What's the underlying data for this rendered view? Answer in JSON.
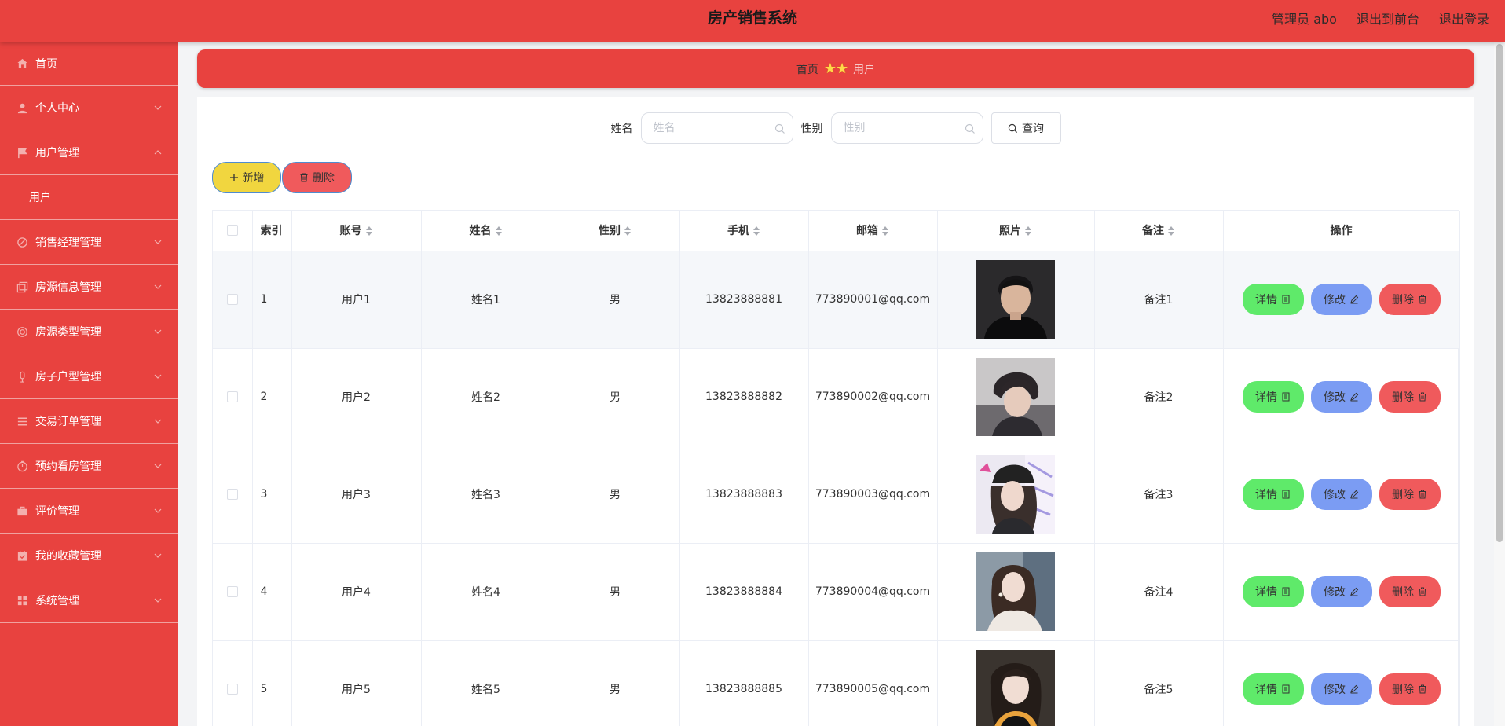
{
  "header": {
    "title": "房产销售系统",
    "admin_label": "管理员 abo",
    "to_front": "退出到前台",
    "logout": "退出登录"
  },
  "sidebar": {
    "items": [
      {
        "label": "首页",
        "icon": "home-icon"
      },
      {
        "label": "个人中心",
        "icon": "user-icon"
      },
      {
        "label": "用户管理",
        "icon": "flag-icon"
      },
      {
        "label": "销售经理管理",
        "icon": "disable-icon"
      },
      {
        "label": "房源信息管理",
        "icon": "copy-document-icon"
      },
      {
        "label": "房源类型管理",
        "icon": "help-icon"
      },
      {
        "label": "房子户型管理",
        "icon": "microphone-icon"
      },
      {
        "label": "交易订单管理",
        "icon": "list-icon"
      },
      {
        "label": "预约看房管理",
        "icon": "timer-icon"
      },
      {
        "label": "评价管理",
        "icon": "suitcase-icon"
      },
      {
        "label": "我的收藏管理",
        "icon": "calendar-icon"
      },
      {
        "label": "系统管理",
        "icon": "grid-icon"
      }
    ],
    "submenu_label": "用户"
  },
  "breadcrumb": {
    "home": "首页",
    "stars": "★★",
    "current": "用户"
  },
  "search": {
    "name_label": "姓名",
    "name_placeholder": "姓名",
    "gender_label": "性别",
    "gender_placeholder": "性别",
    "query_label": "查询"
  },
  "actions": {
    "add_label": "新增",
    "delete_label": "删除"
  },
  "table": {
    "headers": {
      "index": "索引",
      "account": "账号",
      "name": "姓名",
      "gender": "性别",
      "phone": "手机",
      "email": "邮箱",
      "photo": "照片",
      "remark": "备注",
      "ops": "操作"
    },
    "op_labels": {
      "detail": "详情",
      "edit": "修改",
      "remove": "删除"
    },
    "rows": [
      {
        "index": "1",
        "account": "用户1",
        "name": "姓名1",
        "gender": "男",
        "phone": "13823888881",
        "email": "773890001@qq.com",
        "remark": "备注1"
      },
      {
        "index": "2",
        "account": "用户2",
        "name": "姓名2",
        "gender": "男",
        "phone": "13823888882",
        "email": "773890002@qq.com",
        "remark": "备注2"
      },
      {
        "index": "3",
        "account": "用户3",
        "name": "姓名3",
        "gender": "男",
        "phone": "13823888883",
        "email": "773890003@qq.com",
        "remark": "备注3"
      },
      {
        "index": "4",
        "account": "用户4",
        "name": "姓名4",
        "gender": "男",
        "phone": "13823888884",
        "email": "773890004@qq.com",
        "remark": "备注4"
      },
      {
        "index": "5",
        "account": "用户5",
        "name": "姓名5",
        "gender": "男",
        "phone": "13823888885",
        "email": "773890005@qq.com",
        "remark": "备注5"
      }
    ]
  },
  "colors": {
    "theme_red": "#e8423f",
    "add_yellow": "#f1d63f",
    "detail_green": "#5fea6a",
    "edit_blue": "#7b9cf3",
    "delete_red": "#f05a5c"
  }
}
